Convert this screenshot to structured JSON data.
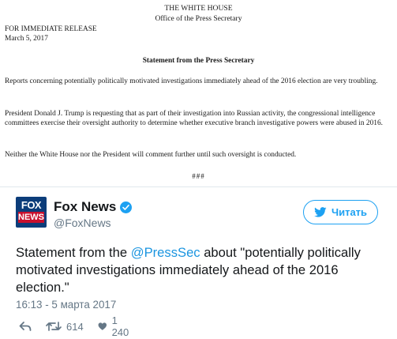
{
  "statement": {
    "org": "THE WHITE HOUSE",
    "office": "Office of the Press Secretary",
    "release": "FOR IMMEDIATE RELEASE",
    "date": "March 5, 2017",
    "title": "Statement from the Press Secretary",
    "paragraphs": [
      "Reports concerning potentially politically motivated investigations immediately ahead of the 2016 election are very troubling.",
      "President Donald J. Trump is requesting that as part of their investigation into Russian activity, the congressional intelligence committees exercise their oversight authority to determine whether executive branch investigative powers were abused in 2016.",
      "Neither the White House nor the President will comment further until such oversight is conducted."
    ],
    "end_mark": "###"
  },
  "tweet": {
    "avatar_top": "FOX",
    "avatar_bottom": "NEWS",
    "name": "Fox News",
    "handle": "@FoxNews",
    "follow_label": "Читать",
    "text_before": "Statement from the ",
    "mention": "@PressSec",
    "text_after": " about \"potentially politically motivated investigations immediately ahead of the 2016 election.\"",
    "timestamp": "16:13 - 5 марта 2017",
    "retweets": "614",
    "likes": "1 240",
    "colors": {
      "accent": "#1da1f2",
      "muted": "#657786",
      "text": "#14171a"
    }
  }
}
